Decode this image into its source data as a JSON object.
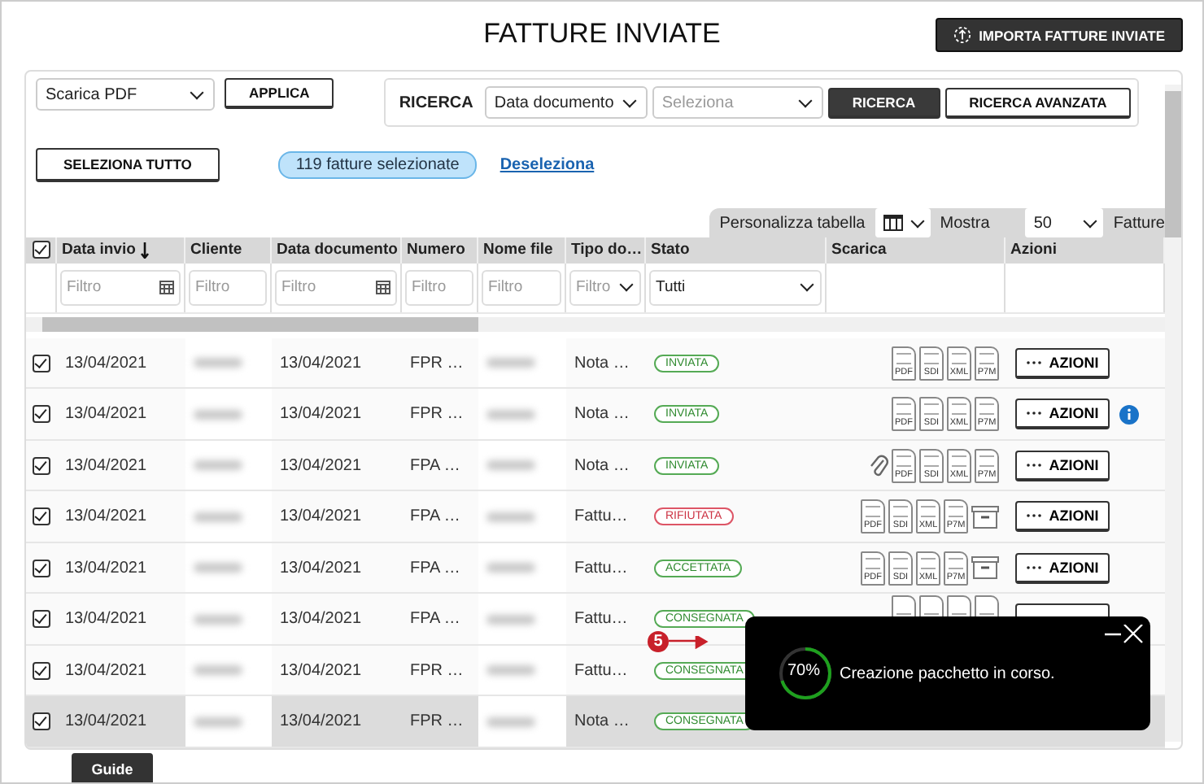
{
  "title": "FATTURE INVIATE",
  "import_button": "IMPORTA FATTURE INVIATE",
  "bulk_action": {
    "value": "Scarica PDF",
    "button": "APPLICA"
  },
  "search": {
    "label": "RICERCA",
    "field": "Data documento",
    "placeholder": "Seleziona",
    "button": "RICERCA",
    "advanced_button": "RICERCA AVANZATA"
  },
  "select_all_button": "SELEZIONA TUTTO",
  "selection_badge": "119 fatture selezionate",
  "deselect_link": "Deseleziona",
  "table_settings": {
    "customize_label": "Personalizza tabella",
    "show_label": "Mostra",
    "page_size": "50",
    "unit_label": "Fatture"
  },
  "table": {
    "all_checked": true,
    "columns": [
      {
        "label": "Data invio",
        "sorted": true,
        "filter": {
          "kind": "date",
          "placeholder": "Filtro"
        }
      },
      {
        "label": "Cliente",
        "sorted": false,
        "filter": {
          "kind": "text",
          "placeholder": "Filtro"
        }
      },
      {
        "label": "Data documento",
        "sorted": false,
        "filter": {
          "kind": "date",
          "placeholder": "Filtro"
        }
      },
      {
        "label": "Numero",
        "sorted": false,
        "filter": {
          "kind": "text",
          "placeholder": "Filtro"
        }
      },
      {
        "label": "Nome file",
        "sorted": false,
        "filter": {
          "kind": "text",
          "placeholder": "Filtro"
        }
      },
      {
        "label": "Tipo do…",
        "sorted": false,
        "filter": {
          "kind": "select",
          "placeholder": "Filtro"
        }
      },
      {
        "label": "Stato",
        "sorted": false,
        "filter": {
          "kind": "select",
          "value": "Tutti"
        }
      },
      {
        "label": "Scarica",
        "sorted": false,
        "filter": {
          "kind": "none"
        }
      },
      {
        "label": "Azioni",
        "sorted": false,
        "filter": {
          "kind": "none"
        }
      }
    ],
    "rows": [
      {
        "checked": true,
        "selected": false,
        "date_sent": "13/04/2021",
        "doc_date": "13/04/2021",
        "number": "FPR …",
        "type": "Nota …",
        "status": {
          "kind": "ok",
          "label": "INVIATA"
        },
        "attachment": false,
        "downloads": [
          "PDF",
          "SDI",
          "XML",
          "P7M"
        ],
        "archive": false,
        "action": "AZIONI",
        "info": false
      },
      {
        "checked": true,
        "selected": false,
        "date_sent": "13/04/2021",
        "doc_date": "13/04/2021",
        "number": "FPR …",
        "type": "Nota …",
        "status": {
          "kind": "ok",
          "label": "INVIATA"
        },
        "attachment": false,
        "downloads": [
          "PDF",
          "SDI",
          "XML",
          "P7M"
        ],
        "archive": false,
        "action": "AZIONI",
        "info": true
      },
      {
        "checked": true,
        "selected": false,
        "date_sent": "13/04/2021",
        "doc_date": "13/04/2021",
        "number": "FPA …",
        "type": "Nota …",
        "status": {
          "kind": "ok",
          "label": "INVIATA"
        },
        "attachment": true,
        "downloads": [
          "PDF",
          "SDI",
          "XML",
          "P7M"
        ],
        "archive": false,
        "action": "AZIONI",
        "info": false
      },
      {
        "checked": true,
        "selected": false,
        "date_sent": "13/04/2021",
        "doc_date": "13/04/2021",
        "number": "FPA …",
        "type": "Fattu…",
        "status": {
          "kind": "error",
          "label": "RIFIUTATA"
        },
        "attachment": false,
        "downloads": [
          "PDF",
          "SDI",
          "XML",
          "P7M"
        ],
        "archive": true,
        "action": "AZIONI",
        "info": false
      },
      {
        "checked": true,
        "selected": false,
        "date_sent": "13/04/2021",
        "doc_date": "13/04/2021",
        "number": "FPA …",
        "type": "Fattu…",
        "status": {
          "kind": "ok",
          "label": "ACCETTATA"
        },
        "attachment": false,
        "downloads": [
          "PDF",
          "SDI",
          "XML",
          "P7M"
        ],
        "archive": true,
        "action": "AZIONI",
        "info": false
      },
      {
        "checked": true,
        "selected": false,
        "date_sent": "13/04/2021",
        "doc_date": "13/04/2021",
        "number": "FPA …",
        "type": "Fattu…",
        "status": {
          "kind": "ok",
          "label": "CONSEGNATA"
        },
        "attachment": false,
        "partial_downloads": [
          {
            "kind": "file"
          },
          {
            "kind": "file"
          },
          {
            "kind": "file"
          },
          {
            "kind": "file"
          }
        ],
        "archive": false,
        "partial_action": true,
        "info": false
      },
      {
        "checked": true,
        "selected": false,
        "date_sent": "13/04/2021",
        "doc_date": "13/04/2021",
        "number": "FPR …",
        "type": "Fattu…",
        "status": {
          "kind": "ok",
          "label": "CONSEGNATA"
        },
        "attachment": false,
        "downloads": [],
        "archive": false,
        "info": false
      },
      {
        "checked": true,
        "selected": true,
        "date_sent": "13/04/2021",
        "doc_date": "13/04/2021",
        "number": "FPR …",
        "type": "Nota …",
        "status": {
          "kind": "ok",
          "label": "CONSEGNATA"
        },
        "attachment": false,
        "downloads": [],
        "archive": false,
        "info": false
      }
    ]
  },
  "step_marker": "5",
  "toast": {
    "level": 0.7,
    "percent": "70%",
    "message": "Creazione pacchetto in corso."
  },
  "guide_tab": "Guide"
}
